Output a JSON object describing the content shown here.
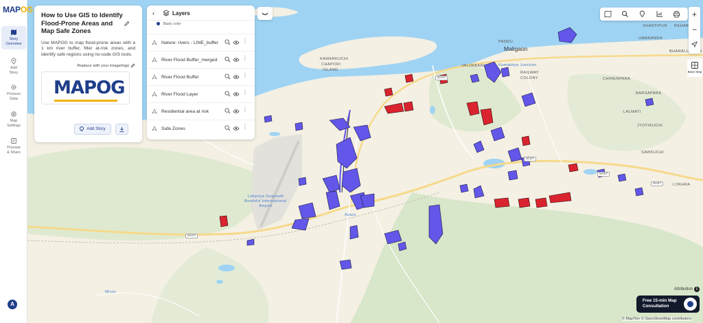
{
  "brand": {
    "name_main": "MAP",
    "name_accent": "OG"
  },
  "rail": {
    "items": [
      {
        "line1": "Story",
        "line2": "Overview",
        "icon": "map-icon",
        "active": true
      },
      {
        "line1": "Add",
        "line2": "Story",
        "icon": "location-pin-icon",
        "active": false
      },
      {
        "line1": "Process",
        "line2": "Data",
        "icon": "gear-icon",
        "active": false
      },
      {
        "line1": "Map",
        "line2": "Settings",
        "icon": "settings-icon",
        "active": false
      },
      {
        "line1": "Preview",
        "line2": "& Share",
        "icon": "share-icon",
        "active": false
      }
    ],
    "help_badge": "A"
  },
  "story": {
    "title": "How to Use GIS to Identify Flood-Prone Areas and Map Safe Zones",
    "description": "Use MAPOG to map flood-prone areas with a 1 km river buffer, filter at-risk zones, and identify safe regions using no-code GIS tools.",
    "replace_logo_label": "Replace with your image/logo",
    "logo_main": "MAP",
    "logo_accent": "OG",
    "add_story_label": "Add Story"
  },
  "layers": {
    "title": "Layers",
    "basic_color_label": "Basic color",
    "items": [
      {
        "name": "Nature: rivers - LINE_buffer"
      },
      {
        "name": "River Flood Buffer_merged"
      },
      {
        "name": "River Flood Buffer"
      },
      {
        "name": "River Flood Layer"
      },
      {
        "name": "Residential area at risk"
      },
      {
        "name": "Safe Zones"
      }
    ]
  },
  "map": {
    "labels": [
      {
        "text": "Maligaon",
        "style": "big"
      },
      {
        "text": "PANDU",
        "style": ""
      },
      {
        "text": "Kamakhya Junction",
        "style": "blue"
      },
      {
        "text": "RAILWAY",
        "style": ""
      },
      {
        "text": "COLONY",
        "style": ""
      },
      {
        "text": "JALUKBARI",
        "style": ""
      },
      {
        "text": "CHIRENPARA",
        "style": ""
      },
      {
        "text": "BARSAPARA",
        "style": ""
      },
      {
        "text": "LALMATI",
        "style": ""
      },
      {
        "text": "JYOTIKUCHI",
        "style": ""
      },
      {
        "text": "SAWKUCHI",
        "style": ""
      },
      {
        "text": "LOKHRA",
        "style": ""
      },
      {
        "text": "SHANTIPUR",
        "style": ""
      },
      {
        "text": "REHABARI",
        "style": ""
      },
      {
        "text": "UMANANDA",
        "style": ""
      },
      {
        "text": "BHARALUMUKH",
        "style": ""
      },
      {
        "text": "KAMARKUCHI",
        "style": ""
      },
      {
        "text": "CHAPORI",
        "style": ""
      },
      {
        "text": "ISLAND",
        "style": ""
      },
      {
        "text": "Lokpriya Gopinath Bordoloi International Airport",
        "style": "blue"
      },
      {
        "text": "Azara",
        "style": "blue"
      },
      {
        "text": "Mirza",
        "style": "blue"
      }
    ],
    "roads": [
      "NH17",
      "NH27",
      "NH27",
      "NH27",
      "NH17"
    ]
  },
  "controls": {
    "zoom_in": "+",
    "zoom_out": "−",
    "basemap_label": "Base Map"
  },
  "footer": {
    "attribution_label": "Attribution",
    "attribution_icon": "i",
    "consult_line1": "Free 15-min Map",
    "consult_line2": "Consultation",
    "copyright": "© MapTiler © OpenStreetMap contributors"
  },
  "colors": {
    "river": "#9fd3f3",
    "safe_zone": "#6257e8",
    "at_risk": "#d9242f",
    "brand": "#1f3e8a",
    "accent": "#f2b200"
  }
}
